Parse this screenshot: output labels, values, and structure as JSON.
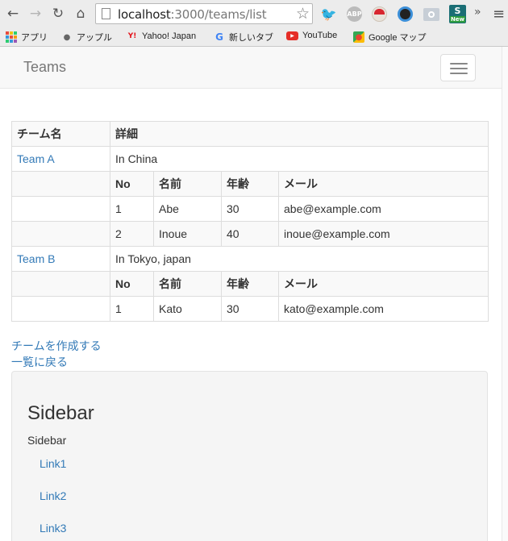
{
  "browser": {
    "url_host": "localhost",
    "url_path": ":3000/teams/list",
    "bookmarks": [
      "アプリ",
      "アップル",
      "Yahoo! Japan",
      "新しいタブ",
      "YouTube",
      "Google マップ"
    ],
    "extensions": {
      "abp": "ABP",
      "new_badge": "New",
      "s_badge": "S"
    },
    "more": "»",
    "menu": "≡"
  },
  "navbar": {
    "brand": "Teams"
  },
  "table": {
    "headers": [
      "チーム名",
      "詳細"
    ],
    "member_headers": [
      "No",
      "名前",
      "年齢",
      "メール"
    ],
    "teams": [
      {
        "name": "Team A",
        "detail": "In China",
        "members": [
          [
            "1",
            "Abe",
            "30",
            "abe@example.com"
          ],
          [
            "2",
            "Inoue",
            "40",
            "inoue@example.com"
          ]
        ]
      },
      {
        "name": "Team B",
        "detail": "In Tokyo, japan",
        "members": [
          [
            "1",
            "Kato",
            "30",
            "kato@example.com"
          ]
        ]
      }
    ]
  },
  "actions": {
    "create": "チームを作成する",
    "back": "一覧に戻る"
  },
  "sidebar": {
    "title": "Sidebar",
    "subtitle": "Sidebar",
    "links": [
      "Link1",
      "Link2",
      "Link3"
    ]
  },
  "colors": {
    "link": "#337ab7",
    "navbar_bg": "#f8f8f8",
    "well_bg": "#f5f5f5",
    "stripe": "#f9f9f9"
  }
}
